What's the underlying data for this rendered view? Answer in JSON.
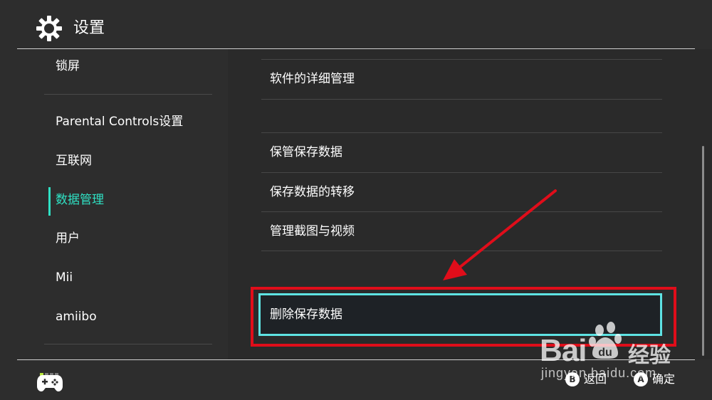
{
  "header": {
    "title": "设置",
    "icon": "gear-icon"
  },
  "sidebar": {
    "items": [
      {
        "label": "锁屏"
      },
      {
        "label": "Parental Controls设置"
      },
      {
        "label": "互联网"
      },
      {
        "label": "数据管理",
        "active": true
      },
      {
        "label": "用户"
      },
      {
        "label": "Mii"
      },
      {
        "label": "amiibo"
      }
    ]
  },
  "main": {
    "items": [
      {
        "label": "软件的详细管理"
      },
      {
        "label": "保管保存数据"
      },
      {
        "label": "保存数据的转移"
      },
      {
        "label": "管理截图与视频"
      }
    ],
    "selected": {
      "label": "删除保存数据"
    }
  },
  "footer": {
    "back": {
      "button": "B",
      "label": "返回"
    },
    "confirm": {
      "button": "A",
      "label": "确定"
    }
  },
  "watermark": {
    "brand": "Bai",
    "brand_suffix": "经验",
    "url": "jingyan.baidu.com"
  },
  "colors": {
    "accent": "#2fe1c4",
    "highlight_border": "#5ee3e3",
    "annotation_red": "#e00d1a"
  }
}
